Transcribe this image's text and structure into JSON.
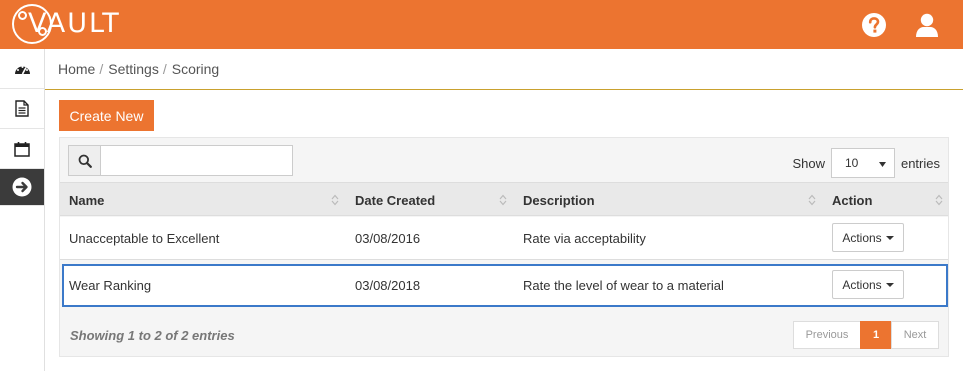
{
  "app": {
    "logo_text": "VAULT"
  },
  "header": {
    "icons": [
      "help-icon",
      "user-icon"
    ]
  },
  "sidebar": {
    "items": [
      {
        "icon": "dashboard-icon",
        "active": false
      },
      {
        "icon": "document-icon",
        "active": false
      },
      {
        "icon": "calendar-icon",
        "active": false
      },
      {
        "icon": "arrow-right-circle-icon",
        "active": true
      }
    ]
  },
  "breadcrumb": {
    "items": [
      "Home",
      "Settings",
      "Scoring"
    ],
    "separator": "/"
  },
  "toolbar": {
    "create_label": "Create New"
  },
  "search": {
    "value": "",
    "placeholder": ""
  },
  "length": {
    "show_label": "Show",
    "selected": "10",
    "entries_label": "entries"
  },
  "table": {
    "columns": [
      "Name",
      "Date Created",
      "Description",
      "Action"
    ],
    "rows": [
      {
        "name": "Unacceptable to Excellent",
        "date": "03/08/2016",
        "description": "Rate via acceptability",
        "action": "Actions"
      },
      {
        "name": "Wear Ranking",
        "date": "03/08/2018",
        "description": "Rate the level of wear to a material",
        "action": "Actions"
      }
    ],
    "info": "Showing 1 to 2 of 2 entries"
  },
  "pagination": {
    "previous": "Previous",
    "current": "1",
    "next": "Next"
  },
  "colors": {
    "accent": "#ec7430",
    "selected_outline": "#3b79c9",
    "sidebar_active": "#3b3b3b"
  }
}
